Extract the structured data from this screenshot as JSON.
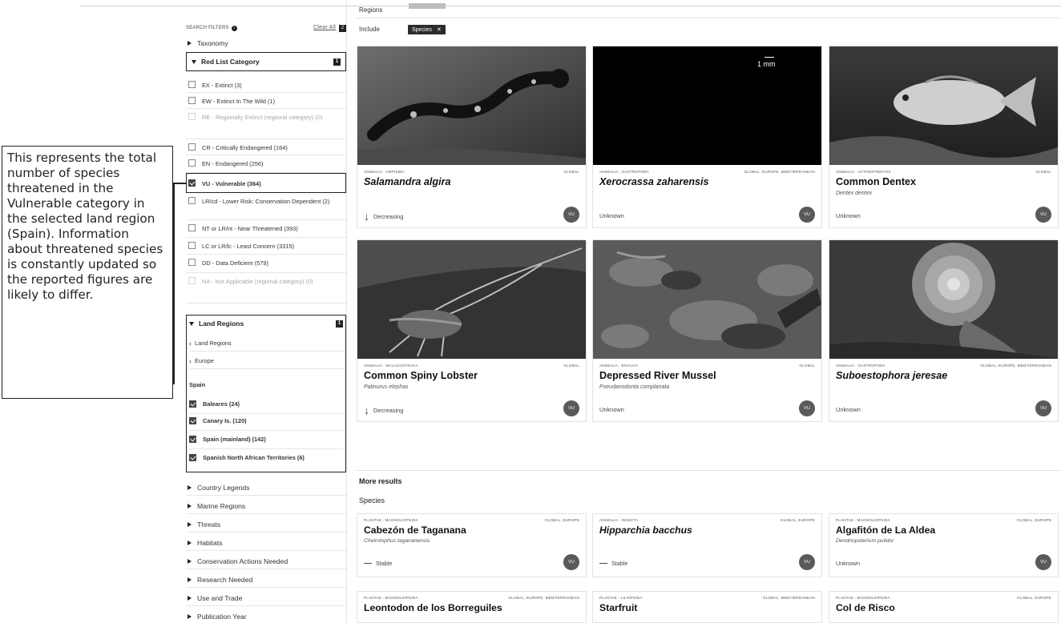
{
  "annotation": {
    "text": "This represents the total number of species threatened in the Vulnerable category in the selected land region (Spain). Information about threatened species is constantly updated so the reported figures are likely to differ."
  },
  "sidebar": {
    "filters_heading": "SEARCH FILTERS",
    "clear_all": "Clear All",
    "clear_count": "2",
    "taxonomy": "Taxonomy",
    "red_list": {
      "title": "Red List Category",
      "count": "1",
      "options": [
        {
          "label": "EX - Extinct (3)",
          "checked": false,
          "dim": false
        },
        {
          "label": "EW - Extinct In The Wild (1)",
          "checked": false,
          "dim": false
        },
        {
          "label": "RE - Regionally Extinct (regional category) (0)",
          "checked": false,
          "dim": true
        },
        {
          "label": "CR - Critically Endangered (164)",
          "checked": false,
          "dim": false
        },
        {
          "label": "EN - Endangered (256)",
          "checked": false,
          "dim": false
        },
        {
          "label": "VU - Vulnerable (364)",
          "checked": true,
          "dim": false
        },
        {
          "label": "LR/cd - Lower Risk: Conservation Dependent (2)",
          "checked": false,
          "dim": false
        },
        {
          "label": "NT or LR/nt - Near Threatened (393)",
          "checked": false,
          "dim": false
        },
        {
          "label": "LC or LR/lc - Least Concern (3315)",
          "checked": false,
          "dim": false
        },
        {
          "label": "DD - Data Deficient (579)",
          "checked": false,
          "dim": false
        },
        {
          "label": "NA - Not Applicable (regional category) (0)",
          "checked": false,
          "dim": true
        }
      ]
    },
    "land_regions": {
      "title": "Land Regions",
      "count": "1",
      "crumbs": [
        "Land Regions",
        "Europe"
      ],
      "group": "Spain",
      "options": [
        {
          "label": "Baleares (24)",
          "checked": true
        },
        {
          "label": "Canary Is. (120)",
          "checked": true
        },
        {
          "label": "Spain (mainland) (142)",
          "checked": true
        },
        {
          "label": "Spanish North African Territories (6)",
          "checked": true
        }
      ]
    },
    "more_filters": [
      "Country Legends",
      "Marine Regions",
      "Threats",
      "Habitats",
      "Conservation Actions Needed",
      "Research Needed",
      "Use and Trade",
      "Publication Year"
    ]
  },
  "main": {
    "regions_label": "Regions",
    "include_label": "Include",
    "chip_label": "Species",
    "chip_close": "✕",
    "more_results": "More results",
    "species_label": "Species",
    "cards": [
      {
        "kicker": "ANIMALIA - AMPHIBIA",
        "scope": "GLOBAL",
        "name": "Salamandra algira",
        "italic": true,
        "sci": "",
        "trend": "Decreasing",
        "arrow": "↓",
        "status": "VU",
        "scale": ""
      },
      {
        "kicker": "ANIMALIA - GASTROPODA",
        "scope": "GLOBAL, EUROPE, MEDITERRANEAN",
        "name": "Xerocrassa zaharensis",
        "italic": true,
        "sci": "",
        "trend": "Unknown",
        "arrow": "",
        "status": "VU",
        "scale": "1 mm"
      },
      {
        "kicker": "ANIMALIA - ACTINOPTERYGII",
        "scope": "GLOBAL",
        "name": "Common Dentex",
        "italic": false,
        "sci": "Dentex dentex",
        "trend": "Unknown",
        "arrow": "",
        "status": "VU",
        "scale": ""
      },
      {
        "kicker": "ANIMALIA - MALACOSTRACA",
        "scope": "GLOBAL",
        "name": "Common Spiny Lobster",
        "italic": false,
        "sci": "Palinurus elephas",
        "trend": "Decreasing",
        "arrow": "↓",
        "status": "VU",
        "scale": ""
      },
      {
        "kicker": "ANIMALIA - BIVALVIA",
        "scope": "GLOBAL",
        "name": "Depressed River Mussel",
        "italic": false,
        "sci": "Pseudanodonta complanata",
        "trend": "Unknown",
        "arrow": "",
        "status": "VU",
        "scale": ""
      },
      {
        "kicker": "ANIMALIA - GASTROPODA",
        "scope": "GLOBAL, EUROPE, MEDITERRANEAN",
        "name": "Suboestophora jeresae",
        "italic": true,
        "sci": "",
        "trend": "Unknown",
        "arrow": "",
        "status": "VU",
        "scale": ""
      }
    ],
    "results": [
      {
        "kicker": "PLANTAE - MAGNOLIOPSIDA",
        "scope": "GLOBAL, EUROPE",
        "name": "Cabezón de Taganana",
        "italic": false,
        "sci": "Cheirolophus tagananensis",
        "trend": "Stable",
        "status": "VU"
      },
      {
        "kicker": "ANIMALIA - INSECTA",
        "scope": "GLOBAL, EUROPE",
        "name": "Hipparchia bacchus",
        "italic": true,
        "sci": "",
        "trend": "Stable",
        "status": "VU"
      },
      {
        "kicker": "PLANTAE - MAGNOLIOPSIDA",
        "scope": "GLOBAL, EUROPE",
        "name": "Algafitón de La Aldea",
        "italic": false,
        "sci": "Dendriopoterium pulidoi",
        "trend": "Unknown",
        "status": "VU"
      },
      {
        "kicker": "PLANTAE - MAGNOLIOPSIDA",
        "scope": "GLOBAL, EUROPE, MEDITERRANEAN",
        "name": "Leontodon de los Borreguiles",
        "italic": false,
        "sci": "",
        "trend": "",
        "status": ""
      },
      {
        "kicker": "PLANTAE - LILIOPSIDA",
        "scope": "GLOBAL, MEDITERRANEAN",
        "name": "Starfruit",
        "italic": false,
        "sci": "",
        "trend": "",
        "status": ""
      },
      {
        "kicker": "PLANTAE - MAGNOLIOPSIDA",
        "scope": "GLOBAL, EUROPE",
        "name": "Col de Risco",
        "italic": false,
        "sci": "",
        "trend": "",
        "status": ""
      }
    ]
  }
}
